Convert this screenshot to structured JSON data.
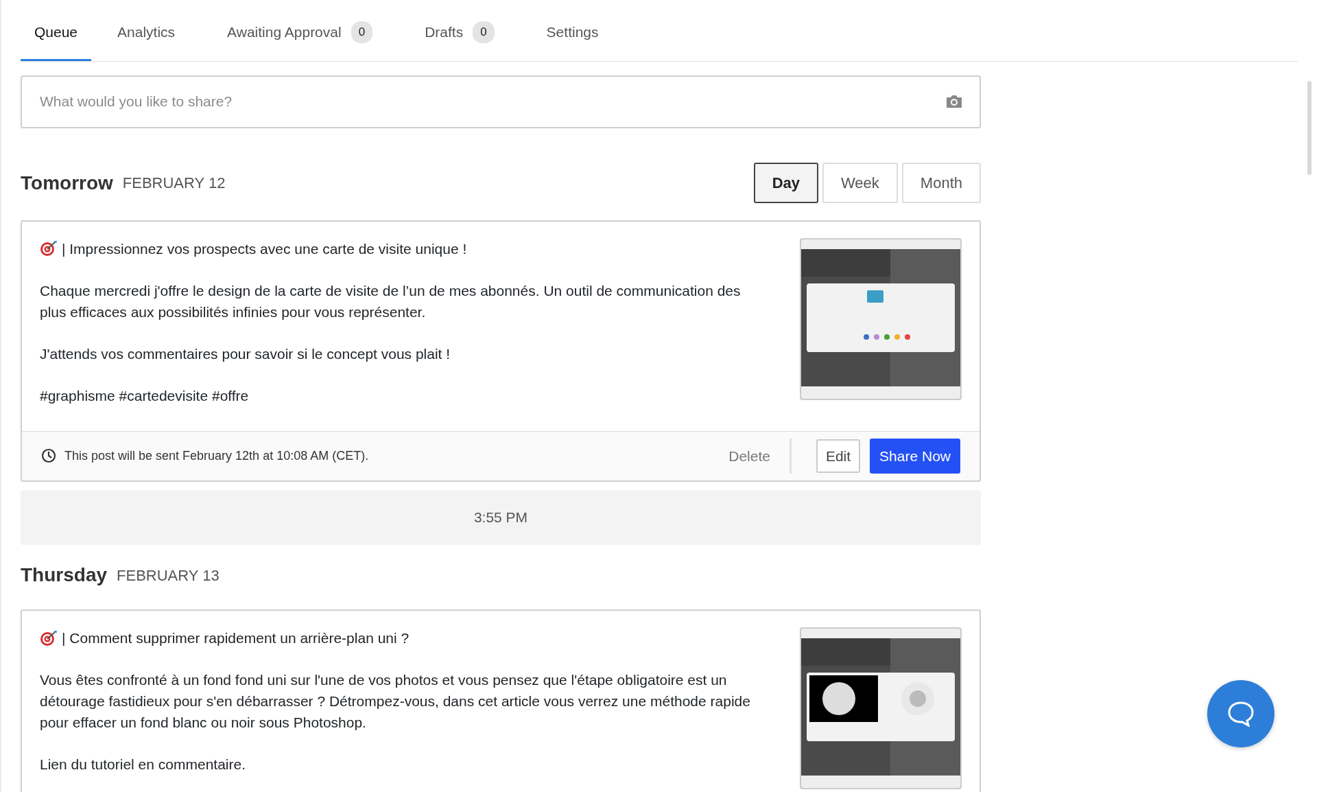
{
  "tabs": [
    {
      "label": "Queue",
      "selected": true
    },
    {
      "label": "Analytics",
      "selected": false
    },
    {
      "label": "Awaiting Approval",
      "count": "0",
      "selected": false
    },
    {
      "label": "Drafts",
      "count": "0",
      "selected": false
    },
    {
      "label": "Settings",
      "selected": false
    }
  ],
  "composer": {
    "placeholder": "What would you like to share?"
  },
  "view_switch": [
    {
      "label": "Day",
      "selected": true
    },
    {
      "label": "Week",
      "selected": false
    },
    {
      "label": "Month",
      "selected": false
    }
  ],
  "sections": [
    {
      "kind": "day",
      "title": "Tomorrow",
      "date": "FEBRUARY 12",
      "posts": [
        {
          "headline": "| Impressionnez vos prospects avec une carte de visite unique !",
          "paragraphs": [
            "Chaque mercredi j'offre le design de la carte de visite de l’un de mes abonnés. Un outil de communication des plus efficaces aux possibilités infinies pour vous représenter.",
            "J'attends vos commentaires pour savoir si le concept vous plait !",
            "#graphisme #cartedevisite #offre"
          ],
          "image": {
            "kind": "picture"
          },
          "footer": {
            "schedule": "This post will be sent February 12th at 10:08 AM (CET).",
            "delete": "Delete",
            "edit": "Edit",
            "share": "Share Now"
          }
        }
      ]
    },
    {
      "kind": "time_slot",
      "time": "3:55 PM"
    },
    {
      "kind": "day",
      "title": "Thursday",
      "date": "FEBRUARY 13",
      "posts": [
        {
          "headline": "| Comment supprimer rapidement un arrière-plan uni ?",
          "paragraphs": [
            "Vous êtes confronté à un fond fond uni sur l'une de vos photos et vous pensez que l'étape obligatoire est un détourage fastidieux pour s'en débarrasser ? Détrompez-vous, dans cet article vous verrez une méthode rapide pour effacer un fond blanc ou noir sous Photoshop.",
            "Lien du tutoriel en commentaire."
          ],
          "image": {
            "kind": "picture"
          }
        }
      ]
    }
  ]
}
